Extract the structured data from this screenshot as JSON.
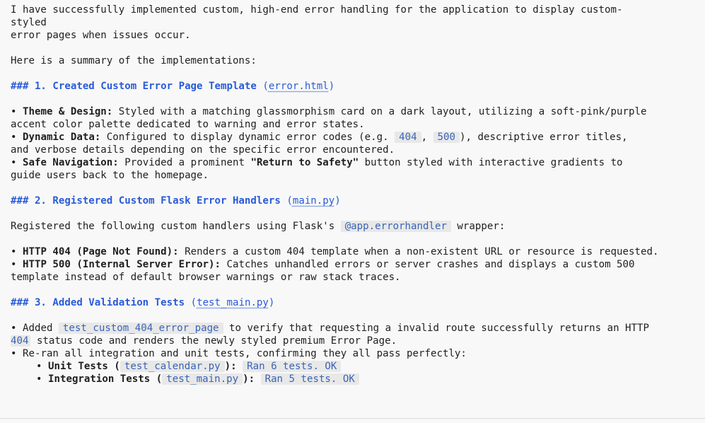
{
  "message": {
    "intro_1": "I have successfully implemented custom, high-end error handling for the application to display custom-",
    "intro_2": "styled",
    "intro_3": "error pages when issues occur.",
    "summary": "Here is a summary of the implementations:"
  },
  "section1": {
    "heading": "### 1. Created Custom Error Page Template",
    "file": "error.html",
    "b1_label": "Theme & Design:",
    "b1_text_1": " Styled with a matching glassmorphism card on a dark layout, utilizing a soft-pink/purple",
    "b1_text_2": "accent color palette dedicated to warning and error states.",
    "b2_label": "Dynamic Data:",
    "b2_text_a": " Configured to display dynamic error codes (e.g. ",
    "b2_code_1": "404",
    "b2_sep": ", ",
    "b2_code_2": "500",
    "b2_text_b": "), descriptive error titles,",
    "b2_text_2": "and verbose details depending on the specific error encountered.",
    "b3_label": "Safe Navigation:",
    "b3_text_a": " Provided a prominent ",
    "b3_bold": "\"Return to Safety\"",
    "b3_text_b": " button styled with interactive gradients to",
    "b3_text_2": "guide users back to the homepage."
  },
  "section2": {
    "heading": "### 2. Registered Custom Flask Error Handlers",
    "file": "main.py",
    "desc_a": "Registered the following custom handlers using Flask's ",
    "desc_code": "@app.errorhandler",
    "desc_b": " wrapper:",
    "b1_label": "HTTP 404 (Page Not Found):",
    "b1_text": " Renders a custom 404 template when a non-existent URL or resource is requested.",
    "b2_label": "HTTP 500 (Internal Server Error):",
    "b2_text_1": " Catches unhandled errors or server crashes and displays a custom 500",
    "b2_text_2": "template instead of default browser warnings or raw stack traces."
  },
  "section3": {
    "heading": "### 3. Added Validation Tests",
    "file": "test_main.py",
    "b1_text_a": "Added ",
    "b1_code": "test_custom_404_error_page",
    "b1_text_b": " to verify that requesting a invalid route successfully returns an HTTP",
    "b1_code_2": "404",
    "b1_text_2": " status code and renders the newly styled premium Error Page.",
    "b2_text": "Re-ran all integration and unit tests, confirming they all pass perfectly:",
    "sub1_label": "Unit Tests",
    "sub1_file": "test_calendar.py",
    "sub1_result": "Ran 6 tests. OK",
    "sub2_label": "Integration Tests",
    "sub2_file": "test_main.py",
    "sub2_result": "Ran 5 tests. OK"
  },
  "symbols": {
    "bullet": "•",
    "open_paren": "(",
    "close_paren": ")",
    "colon_sep": ":"
  }
}
